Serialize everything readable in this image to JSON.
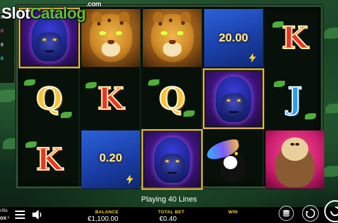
{
  "watermark": {
    "slot": "Slot",
    "catalog": "Catalog",
    "com": ".com"
  },
  "side_panel": {
    "values": [
      "8",
      "0",
      "0",
      "0"
    ]
  },
  "reels": [
    [
      "gorilla",
      "letter-q",
      "letter-k"
    ],
    [
      "jaguar",
      "letter-k",
      "money"
    ],
    [
      "jaguar",
      "letter-q",
      "gorilla"
    ],
    [
      "money",
      "gorilla",
      "toucan"
    ],
    [
      "letter-k",
      "letter-j",
      "sloth"
    ]
  ],
  "letters": {
    "k": "K",
    "q": "Q",
    "j": "J"
  },
  "money_values": {
    "reel4": "20.00",
    "reel2": "0.20"
  },
  "status": {
    "lines_text": "Playing 40 Lines"
  },
  "footer": {
    "brand_top": "rilla",
    "brand_bottom": "ox",
    "balance_label": "BALANCE",
    "balance_value": "€1,100.00",
    "total_bet_label": "TOTAL BET",
    "total_bet_value": "€0.40",
    "win_label": "WIN",
    "win_value": ""
  },
  "colors": {
    "accent_gold": "#d9b24a",
    "label_yellow": "#f0d63a",
    "money_blue": "#1a3fa8"
  },
  "icons": [
    "hamburger-menu-icon",
    "speaker-icon",
    "stack-coins-icon",
    "autoplay-icon",
    "spin-icon"
  ]
}
